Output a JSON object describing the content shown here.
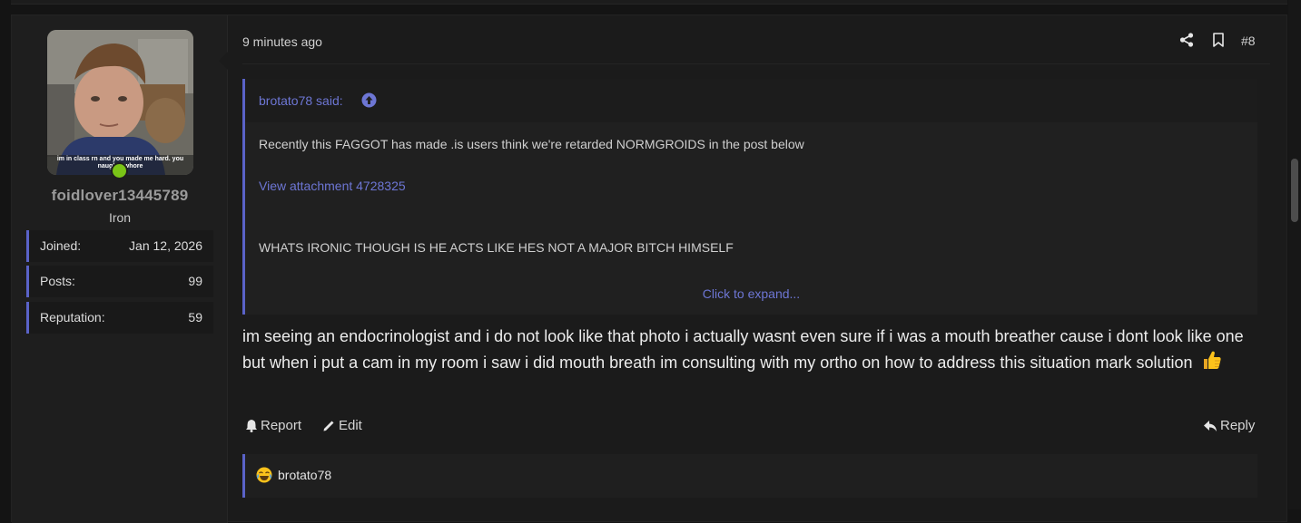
{
  "user": {
    "name": "foidlover13445789",
    "title": "Iron",
    "avatar_caption": "im in class rn and you made me hard. you naughty whore",
    "online_color": "#7ac417",
    "stats": [
      {
        "label": "Joined:",
        "value": "Jan 12, 2026"
      },
      {
        "label": "Posts:",
        "value": "99"
      },
      {
        "label": "Reputation:",
        "value": "59"
      }
    ]
  },
  "post": {
    "time": "9 minutes ago",
    "number": "#8",
    "quote": {
      "author": "brotato78 said:",
      "line1": "Recently this FAGGOT has made .is users think we're retarded NORMGROIDS in the post below",
      "attachment": "View attachment 4728325",
      "line2": "WHATS IRONIC THOUGH IS HE ACTS LIKE HES NOT A MAJOR BITCH HIMSELF",
      "expand": "Click to expand..."
    },
    "body": "im seeing an endocrinologist and i do not look like that photo i actually wasnt even sure if i was a mouth breather cause i dont look like one but when i put a cam in my room i saw i did mouth breath im consulting with my ortho on how to address this situation mark solution",
    "body_emoji": "thumbs-up",
    "actions": {
      "report": "Report",
      "edit": "Edit",
      "reply": "Reply"
    },
    "reaction": {
      "emoji": "crying-laughing",
      "user": "brotato78"
    }
  },
  "colors": {
    "accent": "#5a63c8",
    "link": "#6d76d4",
    "background": "#141414"
  },
  "icons": [
    "share-icon",
    "bookmark-icon",
    "jump-to-quote-icon",
    "bell-icon",
    "pencil-icon",
    "reply-icon",
    "thumbs-up-emoji",
    "crying-laughing-emoji"
  ]
}
